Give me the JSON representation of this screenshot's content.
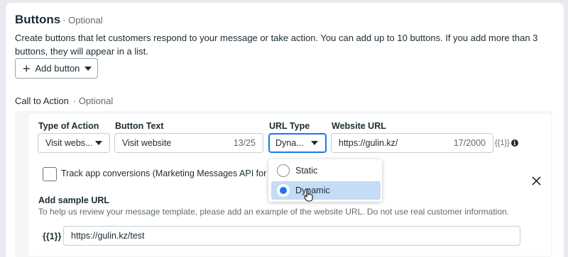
{
  "buttons_section": {
    "title": "Buttons",
    "optional": "· Optional",
    "description": "Create buttons that let customers respond to your message or take action. You can add up to 10 buttons. If you add more than 3 buttons, they will appear in a list.",
    "add_button_label": "Add button"
  },
  "cta": {
    "label": "Call to Action",
    "optional": "· Optional",
    "type_of_action": {
      "label": "Type of Action",
      "value": "Visit webs..."
    },
    "button_text": {
      "label": "Button Text",
      "value": "Visit website",
      "count": "13/25"
    },
    "url_type": {
      "label": "URL Type",
      "value": "Dyna..."
    },
    "website_url": {
      "label": "Website URL",
      "value": "https://gulin.kz/",
      "count": "17/2000",
      "suffix": "{{1}}"
    },
    "track_label": "Track app conversions (Marketing Messages API for WhatsApp)",
    "sample": {
      "title": "Add sample URL",
      "description": "To help us review your message template, please add an example of the website URL. Do not use real customer information.",
      "variable": "{{1}}",
      "value": "https://gulin.kz/test"
    },
    "url_type_options": [
      {
        "label": "Static",
        "selected": false
      },
      {
        "label": "Dynamic",
        "selected": true
      }
    ]
  },
  "icons": [
    "plus-icon",
    "chevron-down-icon",
    "info-icon",
    "close-icon",
    "radio-icon",
    "pointer-cursor-icon"
  ],
  "colors": {
    "accent": "#1877f2",
    "selected_bg": "#c4dcf5",
    "text": "#1c2b33",
    "muted": "#5f6b72"
  }
}
